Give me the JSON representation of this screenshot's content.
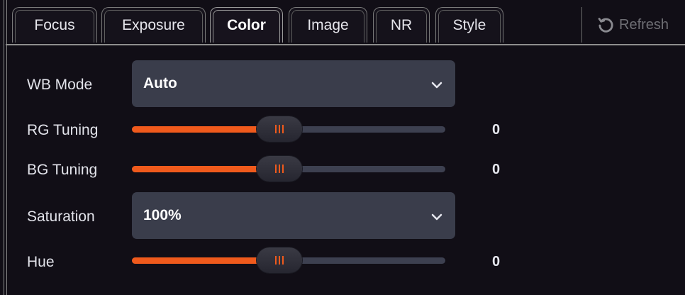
{
  "tabs": [
    {
      "label": "Focus",
      "active": false
    },
    {
      "label": "Exposure",
      "active": false
    },
    {
      "label": "Color",
      "active": true
    },
    {
      "label": "Image",
      "active": false
    },
    {
      "label": "NR",
      "active": false
    },
    {
      "label": "Style",
      "active": false
    }
  ],
  "refresh": {
    "label": "Refresh",
    "icon": "refresh-icon",
    "enabled": false
  },
  "colors": {
    "accent": "#f05a1c",
    "control_bg": "#3a3d4b",
    "background": "#110e16"
  },
  "settings": {
    "wb_mode": {
      "label": "WB Mode",
      "value": "Auto"
    },
    "rg_tuning": {
      "label": "RG Tuning",
      "value": "0",
      "fill_fraction": 0.47
    },
    "bg_tuning": {
      "label": "BG Tuning",
      "value": "0",
      "fill_fraction": 0.47
    },
    "saturation": {
      "label": "Saturation",
      "value": "100%"
    },
    "hue": {
      "label": "Hue",
      "value": "0",
      "fill_fraction": 0.47
    }
  }
}
